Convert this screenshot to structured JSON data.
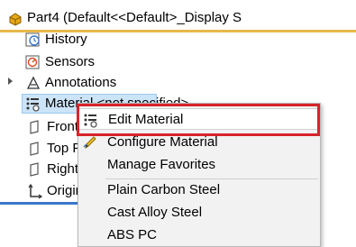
{
  "tree": {
    "root_label": "Part4  (Default<<Default>_Display S",
    "items": [
      {
        "label": "History"
      },
      {
        "label": "Sensors"
      },
      {
        "label": "Annotations"
      },
      {
        "label": "Material <not specified>"
      },
      {
        "label": "Front Plane"
      },
      {
        "label": "Top Plane"
      },
      {
        "label": "Right Plane"
      },
      {
        "label": "Origin"
      }
    ]
  },
  "context_menu": {
    "items": [
      {
        "label": "Edit Material"
      },
      {
        "label": "Configure Material"
      },
      {
        "label": "Manage Favorites"
      },
      {
        "label": "Plain Carbon Steel"
      },
      {
        "label": "Cast Alloy Steel"
      },
      {
        "label": "ABS PC"
      }
    ]
  },
  "colors": {
    "highlight": "#d8232a",
    "root_underline": "#e8b84b",
    "selection": "#cce4f7"
  }
}
